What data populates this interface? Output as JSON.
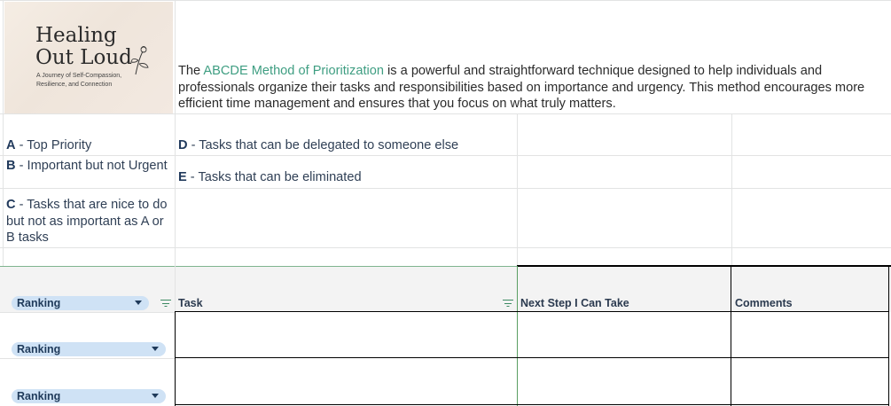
{
  "logo": {
    "title_line1": "Healing",
    "title_line2": "Out Loud",
    "subtitle_line1": "A Journey of Self-Compassion,",
    "subtitle_line2": "Resilience, and Connection"
  },
  "intro": {
    "prefix": "The ",
    "method_name": "ABCDE Method of Prioritization",
    "rest": " is a powerful and straightforward technique designed to help individuals and professionals organize their tasks and responsibilities based on importance and urgency. This method encourages more efficient time management and ensures that you focus on what truly matters."
  },
  "legend": {
    "a_letter": "A",
    "a_text": " - Top Priority",
    "b_letter": "B",
    "b_text": " - Important but not Urgent",
    "c_letter": "C",
    "c_text": " - Tasks that are nice to do but not as important as A or B tasks",
    "d_letter": "D",
    "d_text": " - Tasks that can be delegated to someone else",
    "e_letter": "E",
    "e_text": " - Tasks that can be eliminated"
  },
  "table": {
    "headers": {
      "ranking": "Ranking",
      "task": "Task",
      "next_step": "Next Step I Can Take",
      "comments": "Comments"
    },
    "rows": [
      {
        "ranking": "Ranking",
        "task": "",
        "next_step": "",
        "comments": ""
      },
      {
        "ranking": "Ranking",
        "task": "",
        "next_step": "",
        "comments": ""
      }
    ]
  },
  "colors": {
    "accent": "#3f9e82",
    "chip": "#cfe2f5",
    "filter": "#3d8b63"
  }
}
